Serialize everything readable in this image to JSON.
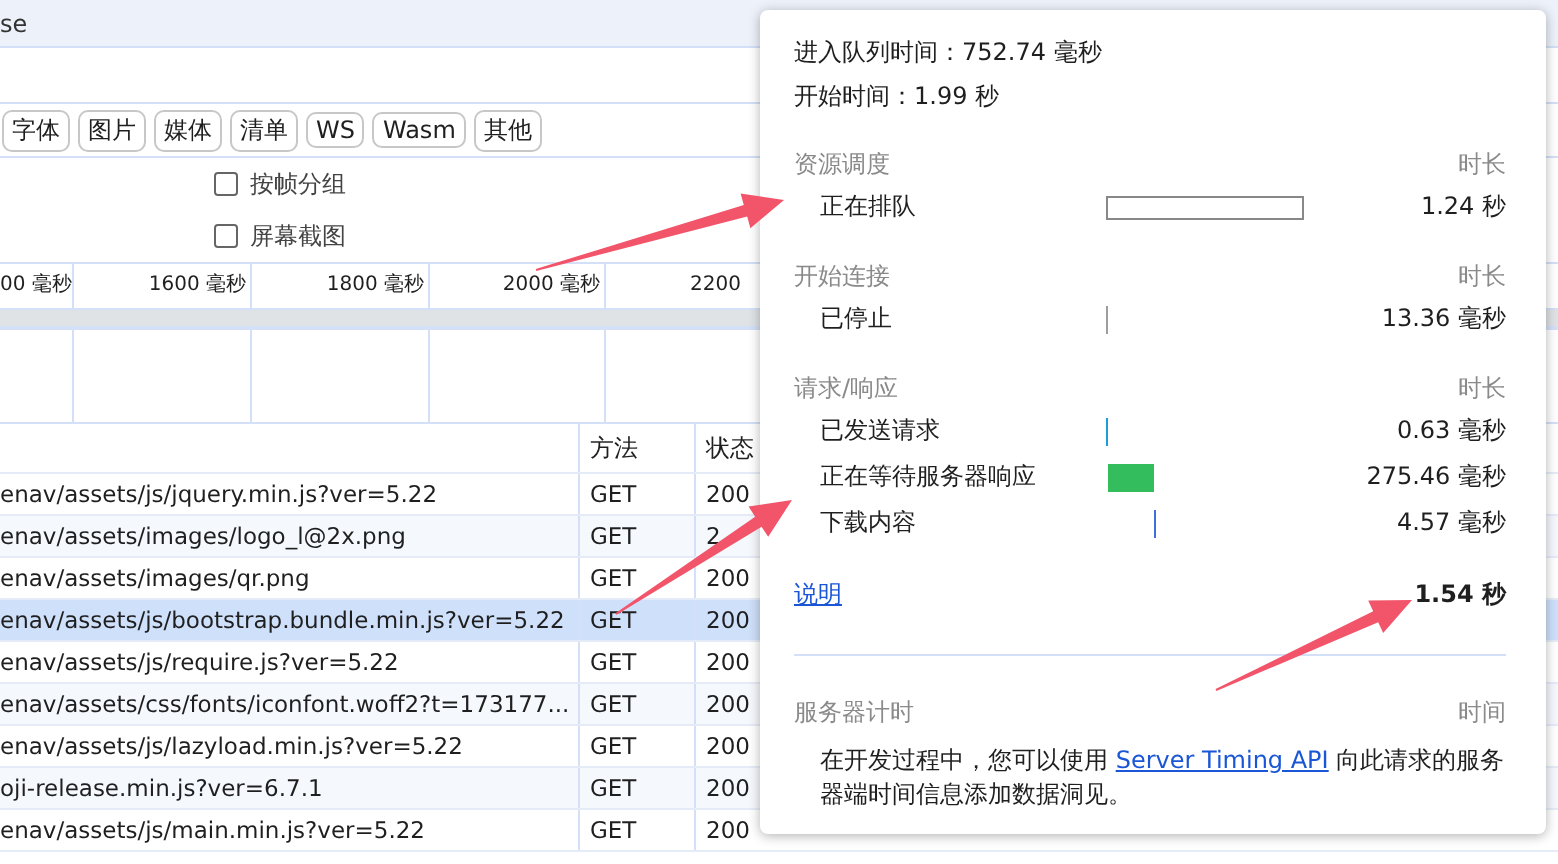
{
  "top_bar": {
    "title": "se"
  },
  "filters": [
    {
      "label": "字体",
      "selected": false
    },
    {
      "label": "图片",
      "selected": false
    },
    {
      "label": "媒体",
      "selected": false
    },
    {
      "label": "清单",
      "selected": false
    },
    {
      "label": "WS",
      "selected": false
    },
    {
      "label": "Wasm",
      "selected": false
    },
    {
      "label": "其他",
      "selected": false
    }
  ],
  "options": [
    {
      "label": "按帧分组",
      "checked": false
    },
    {
      "label": "屏幕截图",
      "checked": false
    }
  ],
  "timeline": {
    "ticks": [
      "00 毫秒",
      "1600 毫秒",
      "1800 毫秒",
      "2000 毫秒",
      "2200"
    ]
  },
  "table": {
    "columns": [
      "方法",
      "状态"
    ],
    "rows": [
      {
        "name": "enav/assets/js/jquery.min.js?ver=5.22",
        "method": "GET",
        "status": "200",
        "selected": false
      },
      {
        "name": "enav/assets/images/logo_l@2x.png",
        "method": "GET",
        "status": "2",
        "selected": false
      },
      {
        "name": "enav/assets/images/qr.png",
        "method": "GET",
        "status": "200",
        "selected": false
      },
      {
        "name": "enav/assets/js/bootstrap.bundle.min.js?ver=5.22",
        "method": "GET",
        "status": "200",
        "selected": true
      },
      {
        "name": "enav/assets/js/require.js?ver=5.22",
        "method": "GET",
        "status": "200",
        "selected": false
      },
      {
        "name": "enav/assets/css/fonts/iconfont.woff2?t=173177...",
        "method": "GET",
        "status": "200",
        "selected": false
      },
      {
        "name": "enav/assets/js/lazyload.min.js?ver=5.22",
        "method": "GET",
        "status": "200",
        "selected": false
      },
      {
        "name": "oji-release.min.js?ver=6.7.1",
        "method": "GET",
        "status": "200",
        "selected": false
      },
      {
        "name": "enav/assets/js/main.min.js?ver=5.22",
        "method": "GET",
        "status": "200",
        "selected": false
      }
    ]
  },
  "timing_popup": {
    "queued_at": "进入队列时间：752.74 毫秒",
    "started_at": "开始时间：1.99 秒",
    "sections": [
      {
        "title": "资源调度",
        "header": "时长",
        "rows": [
          {
            "label": "正在排队",
            "value": "1.24 秒",
            "kind": "outline",
            "color": "#888888"
          }
        ]
      },
      {
        "title": "开始连接",
        "header": "时长",
        "rows": [
          {
            "label": "已停止",
            "value": "13.36 毫秒",
            "kind": "tick",
            "color": "#9e9e9e"
          }
        ]
      },
      {
        "title": "请求/响应",
        "header": "时长",
        "rows": [
          {
            "label": "已发送请求",
            "value": "0.63 毫秒",
            "kind": "tick",
            "color": "#1a9fd9"
          },
          {
            "label": "正在等待服务器响应",
            "value": "275.46 毫秒",
            "kind": "fill",
            "color": "#34bd5d"
          },
          {
            "label": "下载内容",
            "value": "4.57 毫秒",
            "kind": "tick",
            "color": "#3f6fd8"
          }
        ]
      }
    ],
    "explain_link": "说明",
    "total": "1.54 秒",
    "server_timing": {
      "title": "服务器计时",
      "header": "时间",
      "note_before": "在开发过程中，您可以使用 ",
      "link": "Server Timing API",
      "note_after": " 向此请求的服务器端时间信息添加数据洞见。"
    }
  }
}
